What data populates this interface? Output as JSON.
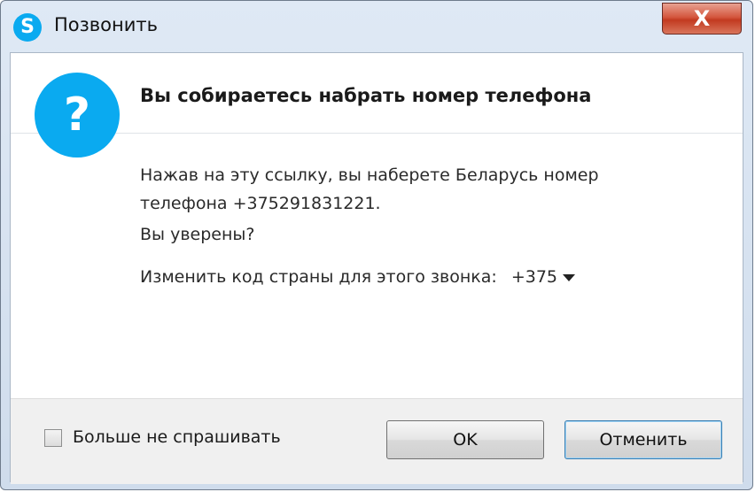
{
  "window": {
    "title": "Позвонить",
    "app_icon": "skype-icon",
    "close_label": "X"
  },
  "dialog": {
    "icon": "question-icon",
    "icon_glyph": "?",
    "heading": "Вы собираетесь набрать номер телефона",
    "message": "Нажав на эту ссылку, вы наберете Беларусь номер телефона +375291831221.",
    "confirm": "Вы уверены?",
    "country_label": "Изменить код страны для этого звонка:",
    "country_code": "+375"
  },
  "footer": {
    "checkbox_label": "Больше не спрашивать",
    "checkbox_checked": false,
    "ok_label": "OK",
    "cancel_label": "Отменить"
  },
  "colors": {
    "accent": "#0aaaf0",
    "close_button": "#c23a20"
  }
}
